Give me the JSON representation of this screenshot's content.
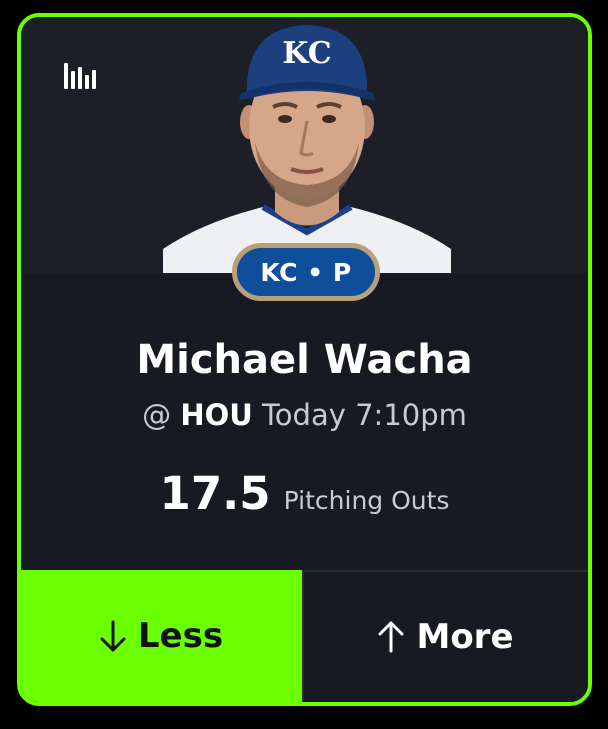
{
  "player": {
    "badge": "KC • P",
    "name": "Michael Wacha",
    "game_prefix": "@",
    "opponent": "HOU",
    "game_time": "Today 7:10pm",
    "cap_logo": "KC"
  },
  "projection": {
    "value": "17.5",
    "stat": "Pitching Outs"
  },
  "buttons": {
    "less_label": "Less",
    "less_icon": "arrow-down-icon",
    "more_label": "More",
    "more_icon": "arrow-up-icon"
  },
  "colors": {
    "accent": "#6cff00",
    "card_bg": "#171923",
    "badge_bg": "#0f4f9a",
    "badge_border": "#b9a07a"
  },
  "icons": {
    "stats": "bar-chart-icon"
  }
}
